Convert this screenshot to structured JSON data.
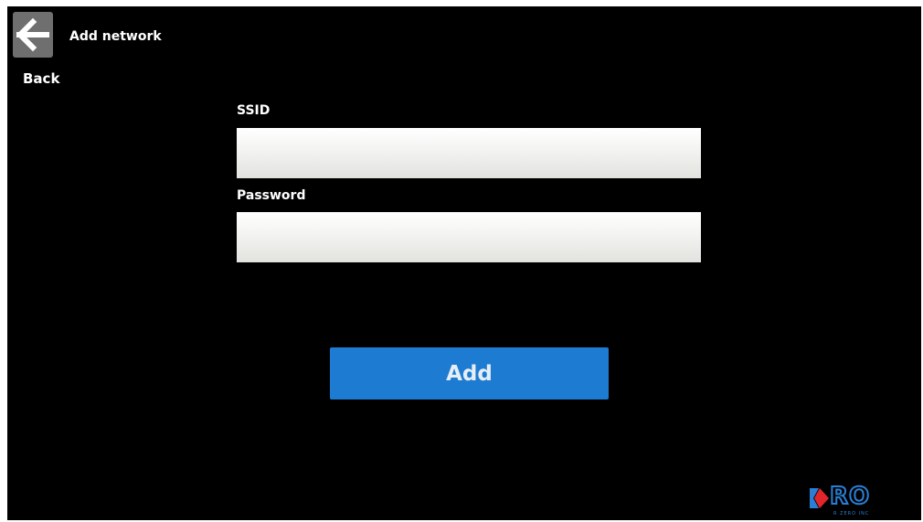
{
  "header": {
    "back_label": "Back",
    "title": "Add network"
  },
  "form": {
    "ssid_label": "SSID",
    "ssid_value": "",
    "password_label": "Password",
    "password_value": "",
    "add_label": "Add"
  },
  "branding": {
    "logo_text": "RO",
    "logo_tagline": "R ZERO INC"
  },
  "icons": {
    "back": "arrow-left-icon",
    "logo_mark": "logo-mark-icon"
  },
  "colors": {
    "background": "#000000",
    "accent": "#1d7bd1",
    "back_button": "#6f6f6f",
    "logo_blue": "#2a7fd4",
    "logo_red": "#e0262b"
  }
}
